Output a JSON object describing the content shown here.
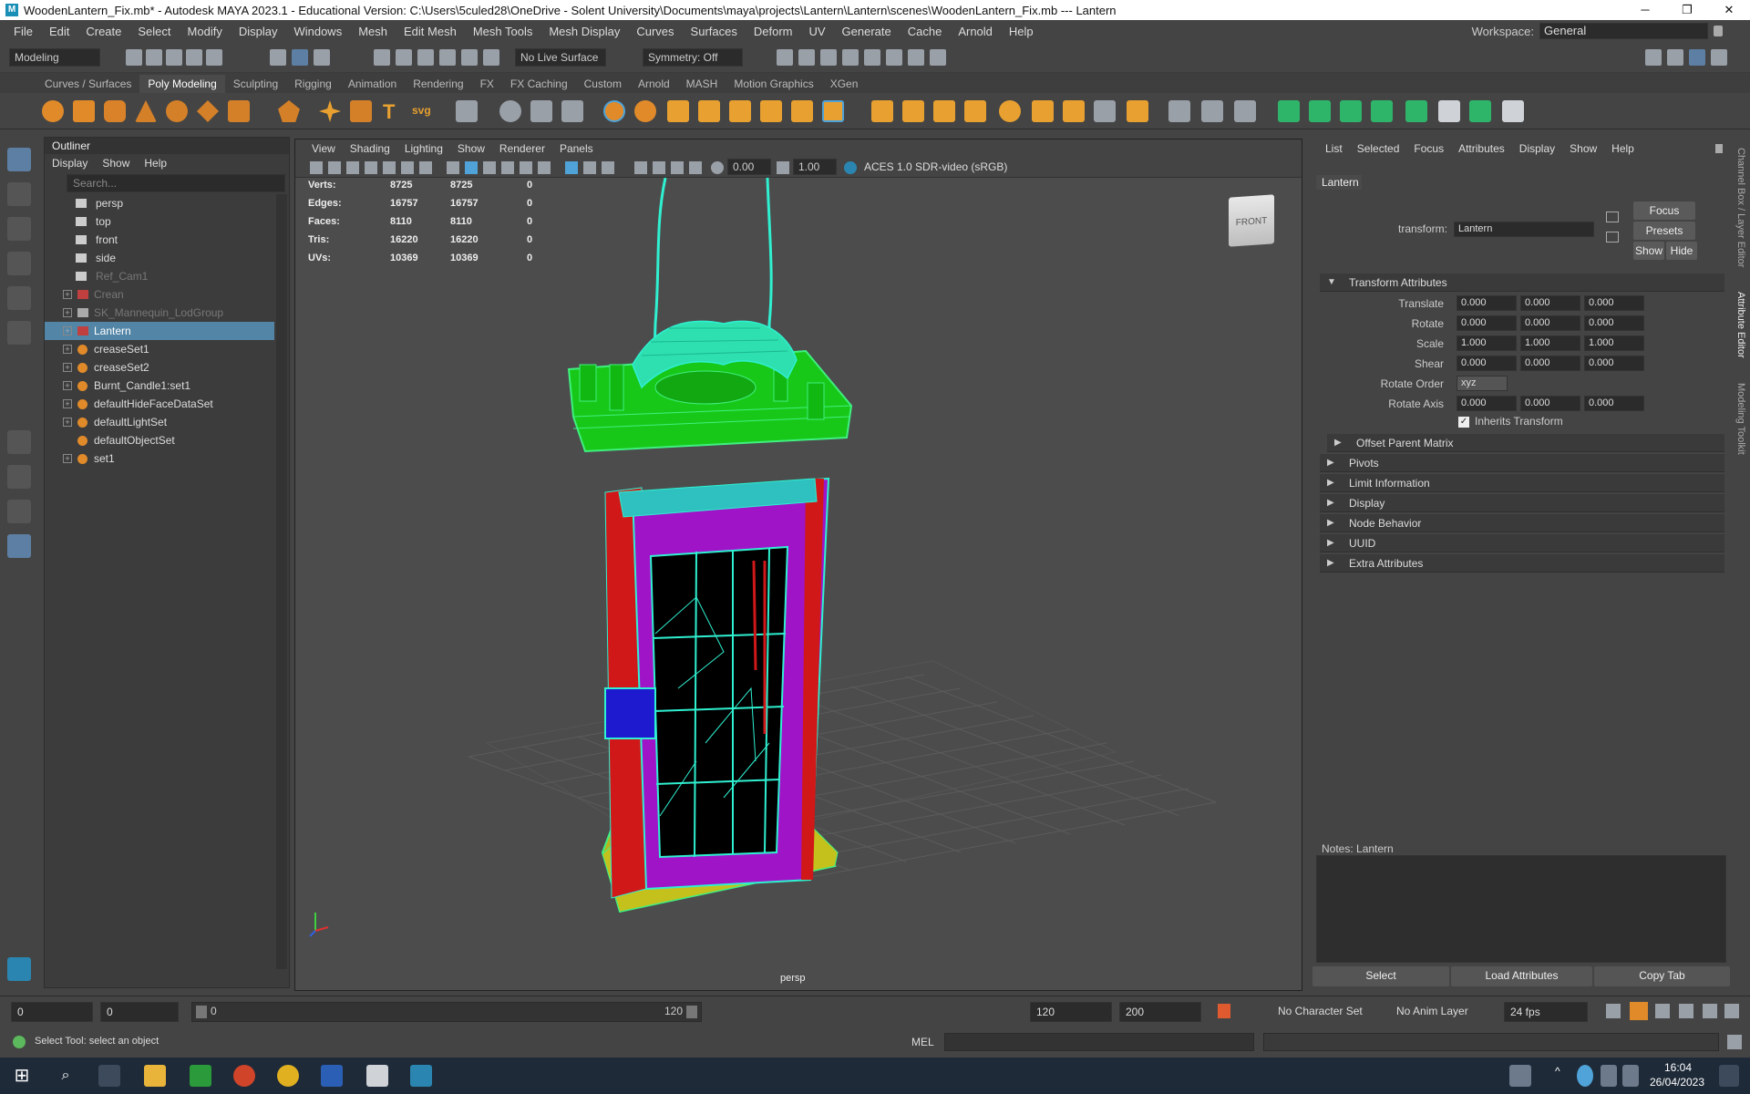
{
  "window": {
    "title": "WoodenLantern_Fix.mb* - Autodesk MAYA 2023.1 - Educational Version: C:\\Users\\5culed28\\OneDrive - Solent University\\Documents\\maya\\projects\\Lantern\\Lantern\\scenes\\WoodenLantern_Fix.mb  ---  Lantern",
    "controls": [
      "─",
      "❐",
      "✕"
    ]
  },
  "menubar": {
    "items": [
      "File",
      "Edit",
      "Create",
      "Select",
      "Modify",
      "Display",
      "Windows",
      "Mesh",
      "Edit Mesh",
      "Mesh Tools",
      "Mesh Display",
      "Curves",
      "Surfaces",
      "Deform",
      "UV",
      "Generate",
      "Cache",
      "Arnold",
      "Help"
    ],
    "workspace_label": "Workspace:",
    "workspace_value": "General"
  },
  "statusline": {
    "menuset": "Modeling",
    "live_surface": "No Live Surface",
    "symmetry": "Symmetry: Off"
  },
  "shelf": {
    "tabs": [
      "Curves / Surfaces",
      "Poly Modeling",
      "Sculpting",
      "Rigging",
      "Animation",
      "Rendering",
      "FX",
      "FX Caching",
      "Custom",
      "Arnold",
      "MASH",
      "Motion Graphics",
      "XGen"
    ],
    "active_tab": "Poly Modeling",
    "svg_label": "svg",
    "text_label": "T"
  },
  "outliner": {
    "title": "Outliner",
    "menus": [
      "Display",
      "Show",
      "Help"
    ],
    "search_placeholder": "Search...",
    "rows": [
      {
        "label": "persp",
        "dim": false,
        "expand": false,
        "icon": "camera-icon"
      },
      {
        "label": "top",
        "dim": false,
        "expand": false,
        "icon": "camera-icon"
      },
      {
        "label": "front",
        "dim": false,
        "expand": false,
        "icon": "camera-icon"
      },
      {
        "label": "side",
        "dim": false,
        "expand": false,
        "icon": "camera-icon"
      },
      {
        "label": "Ref_Cam1",
        "dim": true,
        "expand": false,
        "icon": "camera-icon"
      },
      {
        "label": "Crean",
        "dim": true,
        "expand": true,
        "icon": "transform-icon"
      },
      {
        "label": "SK_Mannequin_LodGroup",
        "dim": true,
        "expand": true,
        "icon": "lodgroup-icon"
      },
      {
        "label": "Lantern",
        "dim": false,
        "expand": true,
        "icon": "transform-icon",
        "selected": true
      },
      {
        "label": "creaseSet1",
        "dim": false,
        "expand": true,
        "icon": "set-icon"
      },
      {
        "label": "creaseSet2",
        "dim": false,
        "expand": true,
        "icon": "set-icon"
      },
      {
        "label": "Burnt_Candle1:set1",
        "dim": false,
        "expand": true,
        "icon": "set-icon"
      },
      {
        "label": "defaultHideFaceDataSet",
        "dim": false,
        "expand": true,
        "icon": "set-icon"
      },
      {
        "label": "defaultLightSet",
        "dim": false,
        "expand": true,
        "icon": "set-icon"
      },
      {
        "label": "defaultObjectSet",
        "dim": false,
        "expand": false,
        "icon": "set-icon"
      },
      {
        "label": "set1",
        "dim": false,
        "expand": true,
        "icon": "set-icon"
      }
    ]
  },
  "viewport": {
    "menus": [
      "View",
      "Shading",
      "Lighting",
      "Show",
      "Renderer",
      "Panels"
    ],
    "exposure": "0.00",
    "gamma": "1.00",
    "color_space": "ACES 1.0 SDR-video (sRGB)",
    "camera_label": "persp",
    "viewcube_label": "FRONT",
    "hud": [
      {
        "label": "Verts:",
        "a": "8725",
        "b": "8725",
        "c": "0"
      },
      {
        "label": "Edges:",
        "a": "16757",
        "b": "16757",
        "c": "0"
      },
      {
        "label": "Faces:",
        "a": "8110",
        "b": "8110",
        "c": "0"
      },
      {
        "label": "Tris:",
        "a": "16220",
        "b": "16220",
        "c": "0"
      },
      {
        "label": "UVs:",
        "a": "10369",
        "b": "10369",
        "c": "0"
      }
    ]
  },
  "attribute_editor": {
    "menus": [
      "List",
      "Selected",
      "Focus",
      "Attributes",
      "Display",
      "Show",
      "Help"
    ],
    "node_tab": "Lantern",
    "transform_label": "transform:",
    "transform_value": "Lantern",
    "buttons": {
      "focus": "Focus",
      "presets": "Presets",
      "show": "Show",
      "hide": "Hide"
    },
    "sections": {
      "transform_attributes": "Transform Attributes",
      "offset_parent_matrix": "Offset Parent Matrix",
      "pivots": "Pivots",
      "limit_information": "Limit Information",
      "display": "Display",
      "node_behavior": "Node Behavior",
      "uuid": "UUID",
      "extra_attributes": "Extra Attributes"
    },
    "attrs": {
      "translate": {
        "label": "Translate",
        "x": "0.000",
        "y": "0.000",
        "z": "0.000"
      },
      "rotate": {
        "label": "Rotate",
        "x": "0.000",
        "y": "0.000",
        "z": "0.000"
      },
      "scale": {
        "label": "Scale",
        "x": "1.000",
        "y": "1.000",
        "z": "1.000"
      },
      "shear": {
        "label": "Shear",
        "x": "0.000",
        "y": "0.000",
        "z": "0.000"
      },
      "rotate_order": {
        "label": "Rotate Order",
        "value": "xyz"
      },
      "rotate_axis": {
        "label": "Rotate Axis",
        "x": "0.000",
        "y": "0.000",
        "z": "0.000"
      },
      "inherits_transform": "Inherits Transform"
    },
    "notes_label": "Notes:  Lantern",
    "bottom_buttons": [
      "Select",
      "Load Attributes",
      "Copy Tab"
    ],
    "side_tabs": [
      "Channel Box / Layer Editor",
      "Attribute Editor",
      "Modeling Toolkit"
    ]
  },
  "timeline": {
    "start": "0",
    "current": "0",
    "range_start": "0",
    "range_end": "120",
    "anim_end": "120",
    "anim_max": "200",
    "character_set": "No Character Set",
    "anim_layer": "No Anim Layer",
    "fps": "24 fps"
  },
  "helpline": {
    "message": "Select Tool: select an object",
    "command_lang": "MEL"
  },
  "taskbar": {
    "time": "16:04",
    "date": "26/04/2023"
  }
}
